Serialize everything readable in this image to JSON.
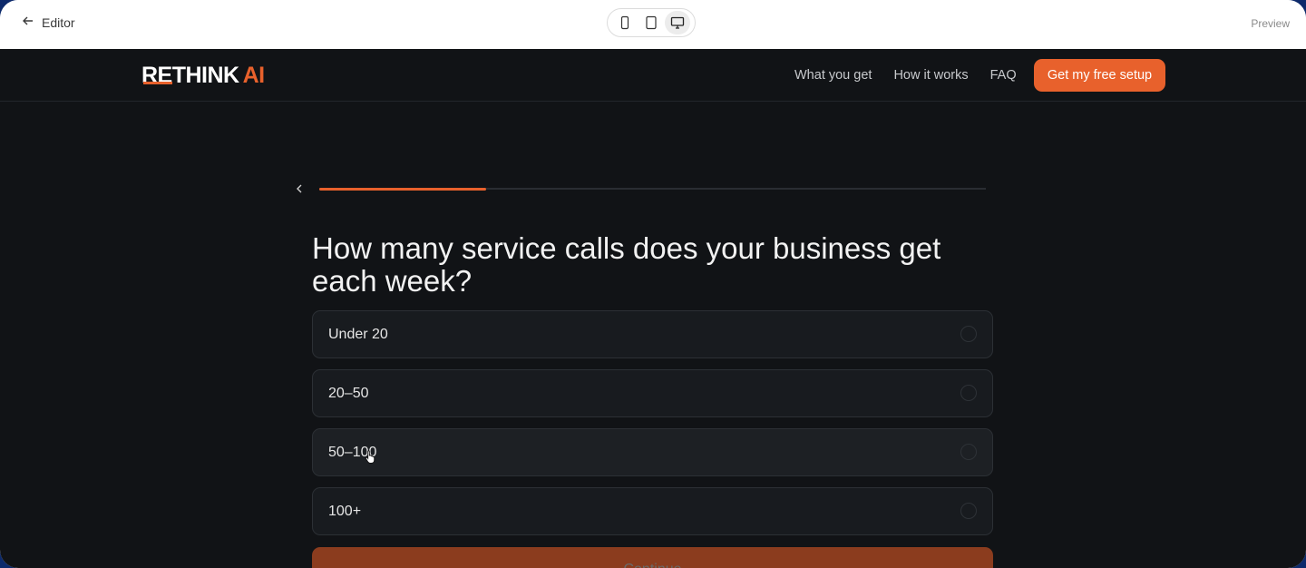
{
  "editor": {
    "back_label": "Editor",
    "preview_label": "Preview",
    "devices": [
      {
        "name": "mobile",
        "icon": "phone-icon"
      },
      {
        "name": "tablet",
        "icon": "tablet-icon"
      },
      {
        "name": "desktop",
        "icon": "monitor-icon",
        "active": true
      }
    ]
  },
  "site": {
    "logo": {
      "part1": "RE",
      "part2": "THINK",
      "part3": "AI"
    },
    "nav": {
      "links": [
        "What you get",
        "How it works",
        "FAQ"
      ],
      "cta_label": "Get my free setup"
    },
    "quiz": {
      "progress": 0.25,
      "question": "How many service calls does your business get each week?",
      "options": [
        "Under 20",
        "20–50",
        "50–100",
        "100+"
      ],
      "continue_label": "Continue"
    }
  },
  "colors": {
    "accent": "#e8612c",
    "background": "#111316",
    "card": "#181b1f"
  }
}
